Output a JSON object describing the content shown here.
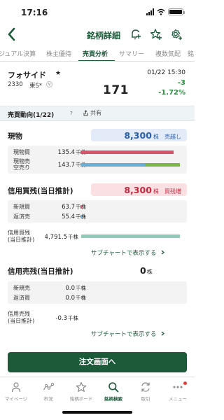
{
  "status_bar": {
    "time": "17:16"
  },
  "nav": {
    "title": "銘柄詳細"
  },
  "tabs": [
    {
      "label": "ジュアル決算"
    },
    {
      "label": "株主優待"
    },
    {
      "label": "売買分析"
    },
    {
      "label": "サマリー"
    },
    {
      "label": "複数気配"
    },
    {
      "label": "銘"
    }
  ],
  "stock": {
    "name": "フォサイド",
    "star": "★",
    "code": "2330",
    "market": "東S*",
    "price": "171",
    "time": "01/22 15:30",
    "change": "-3",
    "change_pct": "-1.72%"
  },
  "trend": {
    "title": "売買動向(1/22)",
    "help": "?",
    "share": "共有"
  },
  "spot": {
    "title": "現物",
    "value": "8,300",
    "unit": "株",
    "status": "売越し",
    "buy_label": "現物買",
    "buy_value": "135.4",
    "buy_unit": "千株",
    "sell_label_1": "現物売",
    "sell_label_2": "空売り",
    "sell_value": "143.7",
    "sell_unit": "千株"
  },
  "margin_buy": {
    "title": "信用買残(当日推計)",
    "value": "8,300",
    "unit": "株",
    "status": "買残増",
    "new_label": "新規買",
    "new_value": "63.7",
    "new_unit": "千株",
    "repay_label": "返済売",
    "repay_value": "55.4",
    "repay_unit": "千株",
    "balance_label_1": "信用買残",
    "balance_label_2": "(当日推計)",
    "balance_value": "4,791.5",
    "balance_unit": "千株",
    "link": "サブチャートで表示する"
  },
  "margin_sell": {
    "title": "信用売残(当日推計)",
    "value": "0",
    "unit": "株",
    "new_label": "新規売",
    "new_value": "0.0",
    "new_unit": "千株",
    "repay_label": "返済買",
    "repay_value": "0.0",
    "repay_unit": "千株",
    "balance_label_1": "信用売残",
    "balance_label_2": "(当日推計)",
    "balance_value": "-0.3",
    "balance_unit": "千株",
    "link": "サブチャートで表示する"
  },
  "order_button": "注文画面へ",
  "tabbar": [
    {
      "label": "マイページ",
      "icon": "person-icon"
    },
    {
      "label": "市況",
      "icon": "market-icon"
    },
    {
      "label": "銘柄ボード",
      "icon": "star-icon"
    },
    {
      "label": "銘柄検索",
      "icon": "search-icon"
    },
    {
      "label": "取引",
      "icon": "trade-icon"
    },
    {
      "label": "メニュー",
      "icon": "menu-icon"
    }
  ],
  "colors": {
    "brand": "#1d5a3a",
    "down": "#2e8b3e",
    "buy_bar": "#d9546a",
    "sell_bar": "#6aaed6",
    "sell_bar_alt": "#7ab648",
    "balance_bar": "#8fc9b8",
    "pill_blue": "#e4ebf8",
    "pill_red": "#fbe0e3"
  }
}
